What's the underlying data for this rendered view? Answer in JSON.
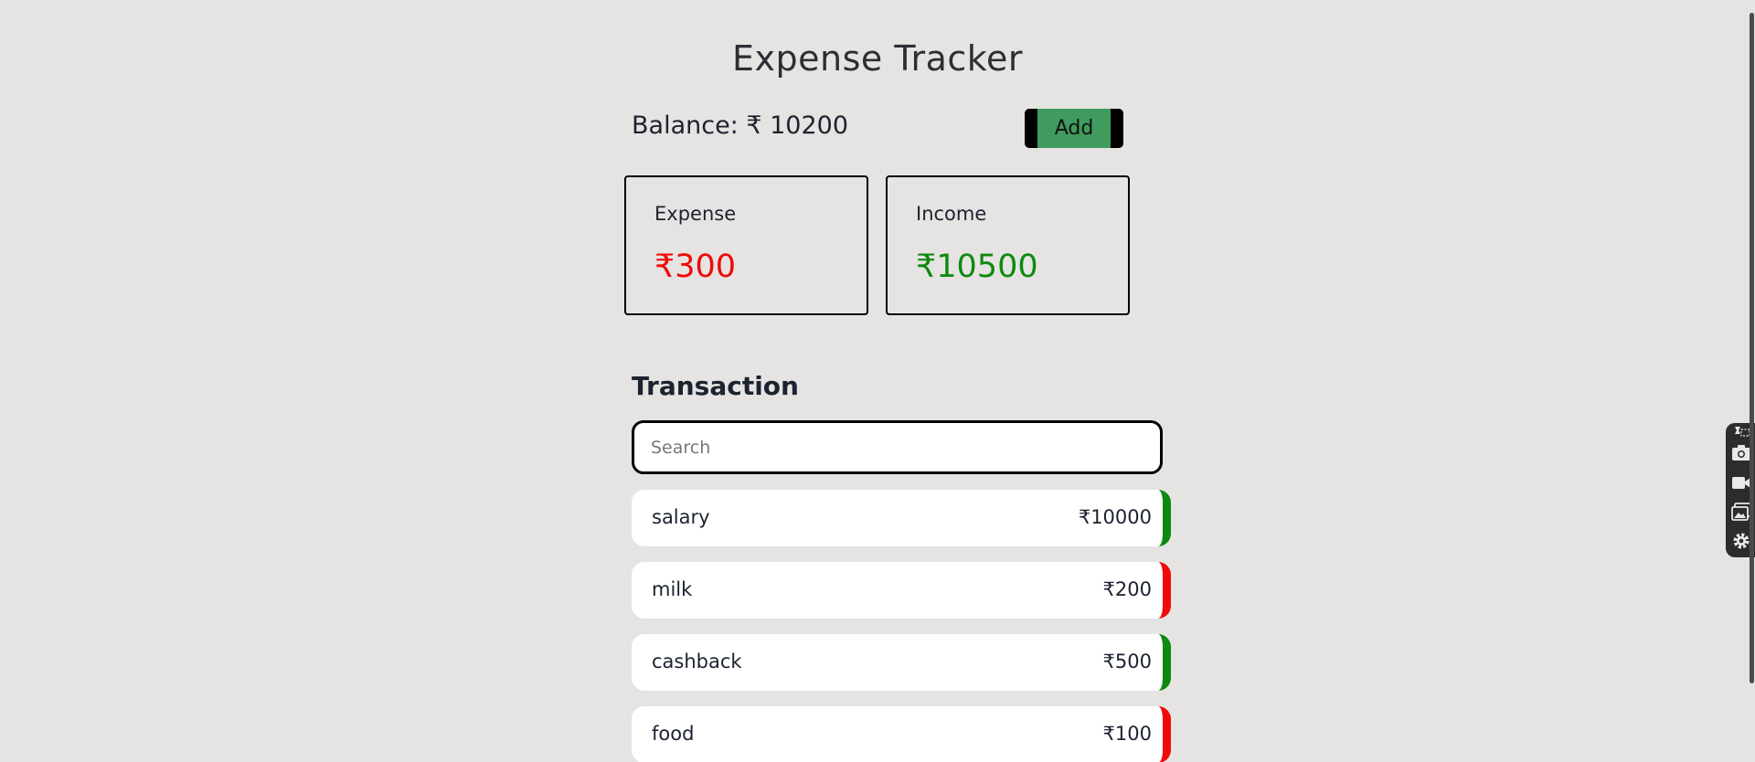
{
  "app": {
    "title": "Expense Tracker",
    "balance_label": "Balance: ₹ 10200",
    "add_label": "Add"
  },
  "summary": {
    "expense": {
      "label": "Expense",
      "amount": "₹300",
      "color": "#f00a0a"
    },
    "income": {
      "label": "Income",
      "amount": "₹10500",
      "color": "#0c8a10"
    }
  },
  "transactions": {
    "heading": "Transaction",
    "search_placeholder": "Search",
    "items": [
      {
        "name": "salary",
        "amount": "₹10000",
        "type": "income"
      },
      {
        "name": "milk",
        "amount": "₹200",
        "type": "expense"
      },
      {
        "name": "cashback",
        "amount": "₹500",
        "type": "income"
      },
      {
        "name": "food",
        "amount": "₹100",
        "type": "expense"
      }
    ]
  },
  "toolbar": {
    "icons": [
      "pin-icon",
      "camera-icon",
      "video-icon",
      "gallery-icon",
      "gear-icon"
    ]
  }
}
